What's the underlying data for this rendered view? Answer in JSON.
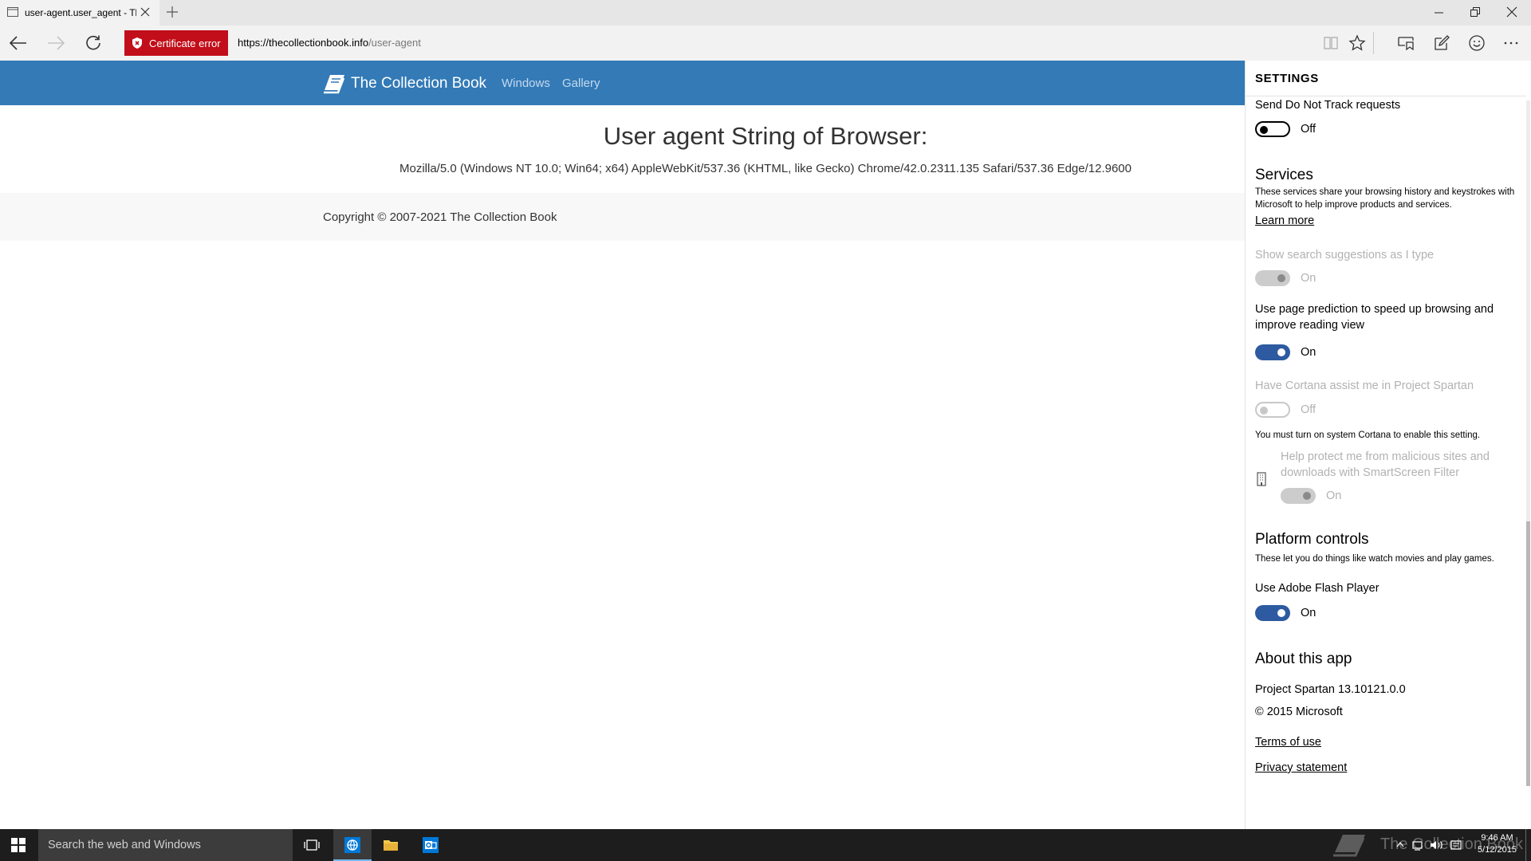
{
  "browser": {
    "tab": {
      "title": "user-agent.user_agent - Th"
    },
    "address": {
      "cert_label": "Certificate error",
      "url_host": "https://thecollectionbook.info",
      "url_path": "/user-agent"
    }
  },
  "site": {
    "brand": "The Collection Book",
    "nav": [
      "Windows",
      "Gallery"
    ],
    "heading": "User agent String of Browser:",
    "ua_string": "Mozilla/5.0 (Windows NT 10.0; Win64; x64) AppleWebKit/537.36 (KHTML, like Gecko) Chrome/42.0.2311.135 Safari/537.36 Edge/12.9600",
    "footer": "Copyright © 2007-2021 The Collection Book",
    "colors": {
      "navbar": "#337ab7",
      "footer_bg": "#f8f8f9"
    }
  },
  "settings": {
    "header": "SETTINGS",
    "dnt": {
      "label": "Send Do Not Track requests",
      "state": "Off"
    },
    "services": {
      "title": "Services",
      "desc": "These services share your browsing history and keystrokes with Microsoft to help improve products and services.",
      "learn_more": "Learn more",
      "search_suggest": {
        "label": "Show search suggestions as I type",
        "state": "On"
      },
      "page_prediction": {
        "label": "Use page prediction to speed up browsing and improve reading view",
        "state": "On"
      },
      "cortana": {
        "label": "Have Cortana assist me in Project Spartan",
        "state": "Off"
      },
      "cortana_note": "You must turn on system Cortana to enable this setting.",
      "smartscreen": {
        "label": "Help protect me from malicious sites and downloads with SmartScreen Filter",
        "state": "On"
      }
    },
    "platform": {
      "title": "Platform controls",
      "desc": "These let you do things like watch movies and play games.",
      "flash": {
        "label": "Use Adobe Flash Player",
        "state": "On"
      }
    },
    "about": {
      "title": "About this app",
      "version": "Project Spartan 13.10121.0.0",
      "copyright": "© 2015 Microsoft",
      "terms": "Terms of use",
      "privacy": "Privacy statement"
    },
    "colors": {
      "toggle_on": "#2d5aa0",
      "toggle_dim": "#cccccc"
    }
  },
  "taskbar": {
    "search_placeholder": "Search the web and Windows",
    "watermark": "The Collection Book",
    "time": "9:46 AM",
    "date": "5/12/2015",
    "colors": {
      "background": "#1d1d1d",
      "search_bg": "#3c3c3c"
    }
  },
  "icons": {
    "tab": "page-icon",
    "close": "close-icon",
    "new_tab": "plus-icon",
    "back": "back-arrow-icon",
    "forward": "forward-arrow-icon",
    "refresh": "refresh-icon",
    "cert": "shield-icon",
    "reading": "reading-view-icon",
    "favorite": "star-icon",
    "hub": "hub-icon",
    "note": "web-note-icon",
    "feedback": "smiley-icon",
    "more": "more-icon"
  }
}
